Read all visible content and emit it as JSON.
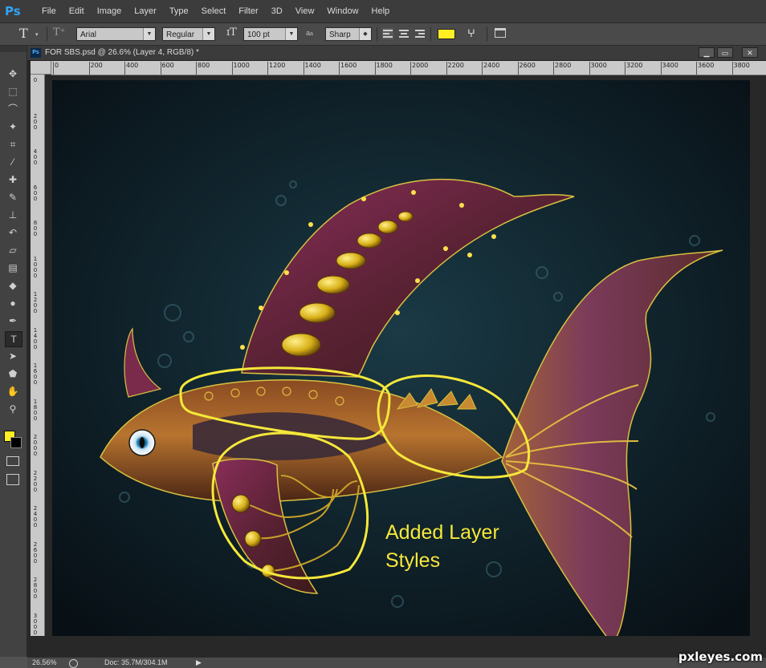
{
  "app": {
    "logo": "Ps"
  },
  "menu": [
    "File",
    "Edit",
    "Image",
    "Layer",
    "Type",
    "Select",
    "Filter",
    "3D",
    "View",
    "Window",
    "Help"
  ],
  "options_bar": {
    "tool_icon": "T",
    "font_family": "Arial",
    "font_style": "Regular",
    "font_size": "100 pt",
    "aa_label": "a",
    "aa_label_small": "a",
    "antialias": "Sharp",
    "text_color": "#ffee22"
  },
  "document": {
    "title": "FOR SBS.psd @ 26.6% (Layer 4, RGB/8) *",
    "tab_icon": "Ps",
    "minimize": "▁",
    "restore": "▭",
    "close": "✕",
    "ruler_h": [
      "0",
      "200",
      "400",
      "600",
      "800",
      "1000",
      "1200",
      "1400",
      "1600",
      "1800",
      "2000",
      "2200",
      "2400",
      "2600",
      "2800",
      "3000",
      "3200",
      "3400",
      "3600",
      "3800"
    ],
    "ruler_v": [
      "0",
      "200",
      "400",
      "600",
      "800",
      "1000",
      "1200",
      "1400",
      "1600",
      "1800",
      "2000",
      "2200",
      "2400",
      "2600",
      "2800",
      "3000"
    ]
  },
  "canvas": {
    "annotation_line1": "Added Layer",
    "annotation_line2": "Styles",
    "highlight_color": "#f5e83a"
  },
  "status": {
    "zoom": "26.56%",
    "doc": "Doc: 35.7M/304.1M"
  },
  "tools": [
    {
      "icon": "move-icon",
      "glyph": "✥"
    },
    {
      "icon": "marquee-icon",
      "glyph": "⬚"
    },
    {
      "icon": "lasso-icon",
      "glyph": "⌒"
    },
    {
      "icon": "magic-wand-icon",
      "glyph": "✦"
    },
    {
      "icon": "crop-icon",
      "glyph": "⌗"
    },
    {
      "icon": "eyedropper-icon",
      "glyph": "⁄"
    },
    {
      "icon": "healing-brush-icon",
      "glyph": "✚"
    },
    {
      "icon": "brush-icon",
      "glyph": "✎"
    },
    {
      "icon": "clone-stamp-icon",
      "glyph": "⊥"
    },
    {
      "icon": "history-brush-icon",
      "glyph": "↶"
    },
    {
      "icon": "eraser-icon",
      "glyph": "▱"
    },
    {
      "icon": "gradient-icon",
      "glyph": "▤"
    },
    {
      "icon": "blur-icon",
      "glyph": "◆"
    },
    {
      "icon": "dodge-icon",
      "glyph": "●"
    },
    {
      "icon": "pen-icon",
      "glyph": "✒"
    },
    {
      "icon": "type-icon",
      "glyph": "T"
    },
    {
      "icon": "path-selection-icon",
      "glyph": "➤"
    },
    {
      "icon": "shape-icon",
      "glyph": "⬟"
    },
    {
      "icon": "hand-icon",
      "glyph": "✋"
    },
    {
      "icon": "zoom-icon",
      "glyph": "⚲"
    }
  ],
  "watermark": "pxleyes.com"
}
